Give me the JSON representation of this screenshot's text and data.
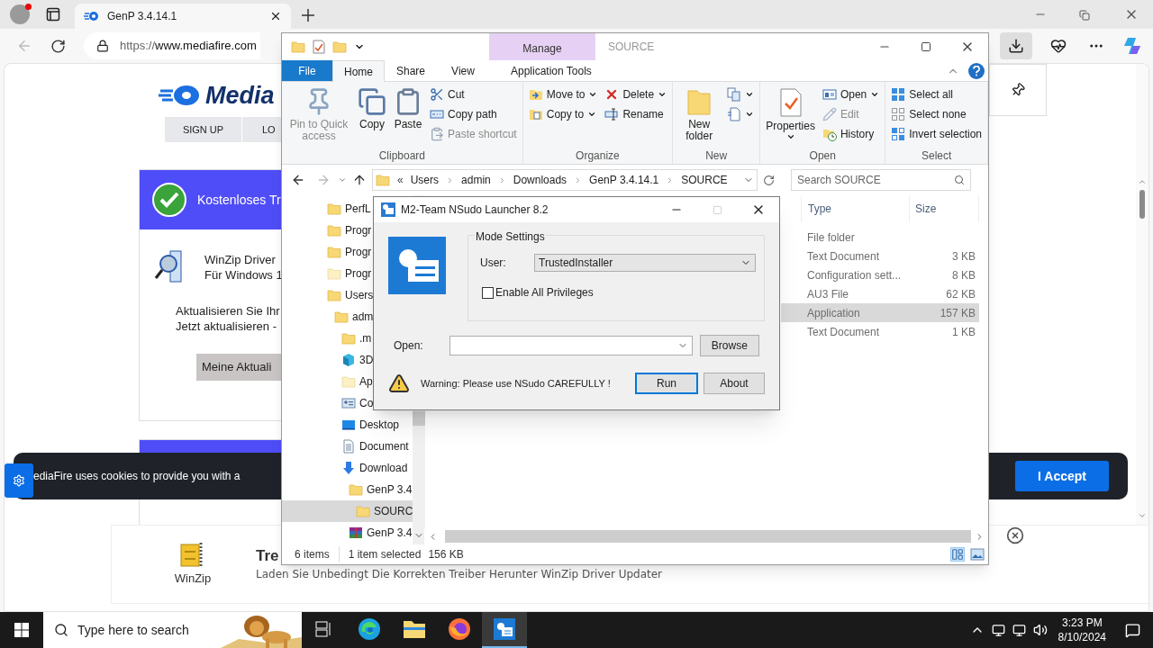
{
  "browser": {
    "tab": {
      "title": "GenP 3.4.14.1"
    },
    "url_prefix": "https://",
    "url_domain": "www.mediafire.com"
  },
  "page": {
    "logo": "Media",
    "nav": [
      "SIGN UP",
      "LO"
    ],
    "ad_card": {
      "header": "Kostenloses Tr",
      "product_line1": "WinZip Driver",
      "product_line2": "Für Windows 1",
      "text_line1": "Aktualisieren Sie Ihr",
      "text_line2": "Jetzt aktualisieren -",
      "button": "Meine Aktuali"
    },
    "cookie_banner": {
      "text": "ediaFire uses cookies to provide you with a",
      "accept": "I Accept"
    },
    "bottom_ad": {
      "brand": "WinZip",
      "title": "Tre",
      "description": "Laden Sie Unbedingt Die Korrekten Treiber Herunter WinZip Driver Updater"
    }
  },
  "explorer": {
    "title": "SOURCE",
    "context_group": "Manage",
    "tabs": [
      {
        "label": "File",
        "kind": "file",
        "selected": false
      },
      {
        "label": "Home",
        "kind": "tab",
        "selected": true
      },
      {
        "label": "Share",
        "kind": "tab",
        "selected": false
      },
      {
        "label": "View",
        "kind": "tab",
        "selected": false
      },
      {
        "label": "Application Tools",
        "kind": "context",
        "selected": false
      }
    ],
    "ribbon": [
      {
        "label": "Clipboard",
        "items": [
          {
            "label": "Pin to Quick access",
            "kind": "pin",
            "disabled": true,
            "menu": false
          },
          {
            "label": "Copy",
            "kind": "copy",
            "disabled": false,
            "menu": false
          },
          {
            "label": "Paste",
            "kind": "paste",
            "disabled": false,
            "menu": false
          },
          {
            "kind": "column",
            "items": [
              {
                "label": "Cut",
                "kind": "cut",
                "disabled": false,
                "menu": false
              },
              {
                "label": "Copy path",
                "kind": "copypath",
                "disabled": false,
                "menu": false
              },
              {
                "label": "Paste shortcut",
                "kind": "pasteshortcut",
                "disabled": true,
                "menu": false
              }
            ]
          }
        ]
      },
      {
        "label": "Organize",
        "items": [
          {
            "kind": "column",
            "items": [
              {
                "label": "Move to",
                "kind": "moveto",
                "disabled": false,
                "menu": true
              },
              {
                "label": "Copy to",
                "kind": "copyto",
                "disabled": false,
                "menu": true
              }
            ]
          },
          {
            "kind": "column",
            "items": [
              {
                "label": "Delete",
                "kind": "delete",
                "disabled": false,
                "menu": true
              },
              {
                "label": "Rename",
                "kind": "rename",
                "disabled": false,
                "menu": false
              }
            ]
          }
        ]
      },
      {
        "label": "New",
        "items": [
          {
            "label": "New folder",
            "kind": "folder",
            "disabled": false,
            "menu": false
          },
          {
            "kind": "column",
            "items": [
              {
                "kind": "newitem",
                "disabled": false,
                "menu": true
              },
              {
                "kind": "easyaccess",
                "disabled": false,
                "menu": true
              }
            ]
          }
        ]
      },
      {
        "label": "Open",
        "items": [
          {
            "label": "Properties",
            "kind": "properties",
            "disabled": false,
            "menu": true
          },
          {
            "kind": "column",
            "items": [
              {
                "label": "Open",
                "kind": "open",
                "disabled": false,
                "menu": true
              },
              {
                "label": "Edit",
                "kind": "edit",
                "disabled": true,
                "menu": false
              },
              {
                "label": "History",
                "kind": "history",
                "disabled": false,
                "menu": false
              }
            ]
          }
        ]
      },
      {
        "label": "Select",
        "items": [
          {
            "kind": "column",
            "items": [
              {
                "label": "Select all",
                "kind": "selectall",
                "disabled": false,
                "menu": false
              },
              {
                "label": "Select none",
                "kind": "selectnone",
                "disabled": false,
                "menu": false
              },
              {
                "label": "Invert selection",
                "kind": "invert",
                "disabled": false,
                "menu": false
              }
            ]
          }
        ]
      }
    ],
    "breadcrumb_overflow": "«",
    "breadcrumb": [
      "Users",
      "admin",
      "Downloads",
      "GenP 3.4.14.1",
      "SOURCE"
    ],
    "search": {
      "placeholder": "Search SOURCE"
    },
    "nav_tree": [
      {
        "label": "PerfL",
        "kind": "folder",
        "selected": false
      },
      {
        "label": "Progr",
        "kind": "folder",
        "selected": false
      },
      {
        "label": "Progr",
        "kind": "folder",
        "selected": false
      },
      {
        "label": "Progr",
        "kind": "folderpale",
        "selected": false
      },
      {
        "label": "Users",
        "kind": "folder",
        "selected": false,
        "children": [
          {
            "label": "adm",
            "kind": "folder",
            "selected": false,
            "children": [
              {
                "label": ".m",
                "kind": "folder",
                "selected": false
              },
              {
                "label": "3D",
                "kind": "cube",
                "selected": false
              },
              {
                "label": "Ap",
                "kind": "folderpale",
                "selected": false
              },
              {
                "label": "Co",
                "kind": "contacts",
                "selected": false
              },
              {
                "label": "Desktop",
                "kind": "desktop",
                "selected": false
              },
              {
                "label": "Document",
                "kind": "document",
                "selected": false
              },
              {
                "label": "Download",
                "kind": "download",
                "selected": false,
                "children": [
                  {
                    "label": "GenP 3.4",
                    "kind": "folder",
                    "selected": false,
                    "children": [
                      {
                        "label": "SOURC",
                        "kind": "folder",
                        "selected": true
                      }
                    ]
                  },
                  {
                    "label": "GenP 3.4",
                    "kind": "archive",
                    "selected": false
                  }
                ]
              }
            ]
          }
        ]
      }
    ],
    "columns": [
      "Type",
      "Size"
    ],
    "files": [
      {
        "type": "File folder",
        "selected": false
      },
      {
        "type": "Text Document",
        "size": "3 KB",
        "selected": false
      },
      {
        "type": "Configuration sett...",
        "size": "8 KB",
        "selected": false
      },
      {
        "type": "AU3 File",
        "size": "62 KB",
        "selected": false
      },
      {
        "type": "Application",
        "size": "157 KB",
        "selected": true
      },
      {
        "type": "Text Document",
        "size": "1 KB",
        "selected": false
      }
    ],
    "status_bar": {
      "count": "6 items",
      "selection": "1 item selected",
      "selection_size": "156 KB"
    }
  },
  "dialog": {
    "title": "M2-Team NSudo Launcher 8.2",
    "group": "Mode Settings",
    "user_label": "User:",
    "user_value": "TrustedInstaller",
    "privileges": {
      "label": "Enable All Privileges",
      "checked": false
    },
    "open_label": "Open:",
    "browse": "Browse",
    "warning": "Warning: Please use NSudo CAREFULLY !",
    "run": "Run",
    "about": "About"
  },
  "taskbar": {
    "search_placeholder": "Type here to search",
    "apps": [
      {
        "kind": "taskview",
        "selected": false
      },
      {
        "kind": "edge",
        "selected": false
      },
      {
        "kind": "explorer",
        "selected": false
      },
      {
        "kind": "firefox",
        "selected": false
      },
      {
        "kind": "nsudo",
        "selected": true
      }
    ],
    "time": "3:23 PM",
    "date": "8/10/2024"
  }
}
